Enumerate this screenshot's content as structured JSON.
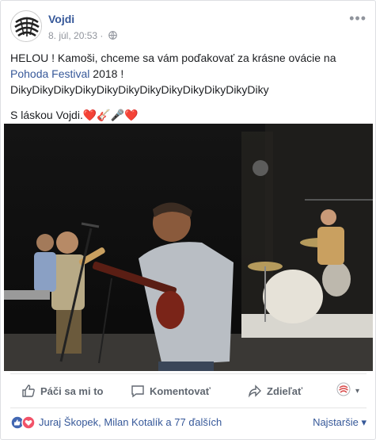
{
  "post": {
    "author": "Vojdi",
    "timestamp": "8. júl, 20:53 ·",
    "privacy_icon": "globe-icon",
    "text_line1a": "HELOU ! Kamoši, chceme sa vám poďakovať za krásne ovácie na",
    "festival_link": "Pohoda Festival",
    "text_line2b": " 2018 !",
    "thanks_line": "DikyDikyDikyDikyDikyDikyDikyDikyDikyDikyDikyDiky",
    "sign_off": "S láskou Vojdi.",
    "emoji_sign_off": "❤️🎸🎤❤️"
  },
  "actions": {
    "like_label": "Páči sa mi to",
    "comment_label": "Komentovať",
    "share_label": "Zdieľať"
  },
  "reactions": {
    "names": "Juraj Škopek, Milan Kotalík a 77 ďalších",
    "sort_label": "Najstaršie ▾"
  },
  "colors": {
    "link": "#365899",
    "meta": "#90949c",
    "action": "#606770",
    "like_blue": "#4267b2",
    "love_red": "#f25268"
  }
}
